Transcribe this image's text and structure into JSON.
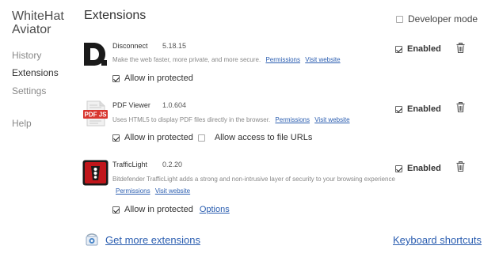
{
  "sidebar": {
    "brand_line1": "WhiteHat",
    "brand_line2": "Aviator",
    "items": [
      {
        "label": "History"
      },
      {
        "label": "Extensions"
      },
      {
        "label": "Settings"
      },
      {
        "label": "Help"
      }
    ]
  },
  "header": {
    "title": "Extensions",
    "developer_mode_label": "Developer mode",
    "developer_mode_checked": false
  },
  "extensions": [
    {
      "name": "Disconnect",
      "version": "5.18.15",
      "description": "Make the web faster, more private, and more secure.",
      "links": [
        "Permissions",
        "Visit website"
      ],
      "options": [
        "Allow in protected"
      ],
      "enabled_label": "Enabled",
      "enabled": true,
      "icon": "disconnect-logo",
      "icon_color": "#1a1a1a"
    },
    {
      "name": "PDF Viewer",
      "version": "1.0.604",
      "description": "Uses HTML5 to display PDF files directly in the browser.",
      "links": [
        "Permissions",
        "Visit website"
      ],
      "options": [
        "Allow in protected",
        "Allow access to file URLs"
      ],
      "enabled_label": "Enabled",
      "enabled": true,
      "icon": "pdfjs-logo",
      "icon_text": "PDF JS",
      "icon_color": "#d8362f"
    },
    {
      "name": "TrafficLight",
      "version": "0.2.20",
      "description": "Bitdefender TrafficLight adds a strong and non-intrusive layer of security to your browsing experience",
      "links": [
        "Permissions",
        "Visit website"
      ],
      "options": [
        "Allow in protected"
      ],
      "options_link": "Options",
      "enabled_label": "Enabled",
      "enabled": true,
      "icon": "trafficlight-logo",
      "icon_color": "#c0161b"
    }
  ],
  "footer": {
    "get_more_label": "Get more extensions",
    "shortcuts_label": "Keyboard shortcuts"
  }
}
